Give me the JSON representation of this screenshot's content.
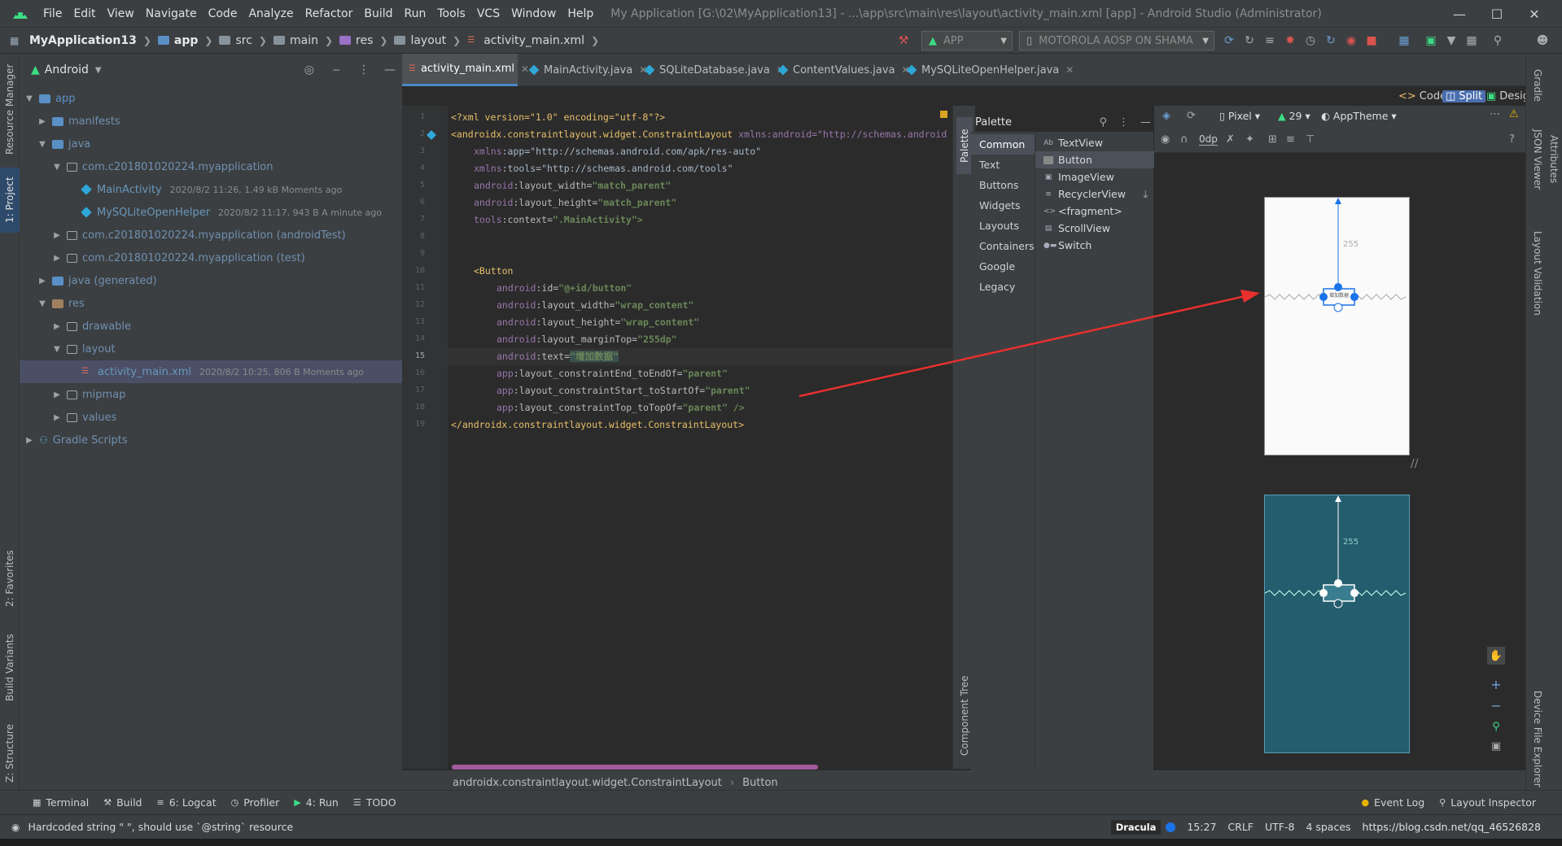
{
  "window": {
    "title": "My Application [G:\\02\\MyApplication13] - ...\\app\\src\\main\\res\\layout\\activity_main.xml [app] - Android Studio (Administrator)",
    "menu": [
      "File",
      "Edit",
      "View",
      "Navigate",
      "Code",
      "Analyze",
      "Refactor",
      "Build",
      "Run",
      "Tools",
      "VCS",
      "Window",
      "Help"
    ]
  },
  "navbar": {
    "crumbs": [
      "MyApplication13",
      "app",
      "src",
      "main",
      "res",
      "layout",
      "activity_main.xml"
    ],
    "run_config": "APP",
    "device": "MOTOROLA AOSP ON SHAMA"
  },
  "project": {
    "view_label": "Android",
    "tree": [
      {
        "label": "app",
        "meta": ""
      },
      {
        "label": "manifests",
        "meta": ""
      },
      {
        "label": "java",
        "meta": ""
      },
      {
        "label": "com.c201801020224.myapplication",
        "meta": ""
      },
      {
        "label": "MainActivity",
        "meta": "2020/8/2 11:26, 1.49 kB  Moments ago"
      },
      {
        "label": "MySQLiteOpenHelper",
        "meta": "2020/8/2 11:17, 943 B  A minute ago"
      },
      {
        "label": "com.c201801020224.myapplication (androidTest)",
        "meta": ""
      },
      {
        "label": "com.c201801020224.myapplication (test)",
        "meta": ""
      },
      {
        "label": "java (generated)",
        "meta": ""
      },
      {
        "label": "res",
        "meta": ""
      },
      {
        "label": "drawable",
        "meta": ""
      },
      {
        "label": "layout",
        "meta": ""
      },
      {
        "label": "activity_main.xml",
        "meta": "2020/8/2 10:25, 806 B  Moments ago"
      },
      {
        "label": "mipmap",
        "meta": ""
      },
      {
        "label": "values",
        "meta": ""
      },
      {
        "label": "Gradle Scripts",
        "meta": ""
      }
    ]
  },
  "left_strip": {
    "resource_manager": "Resource Manager",
    "project": "1: Project",
    "favorites": "2: Favorites",
    "build_variants": "Build Variants",
    "structure": "Z: Structure"
  },
  "editor": {
    "tabs": [
      "activity_main.xml",
      "MainActivity.java",
      "SQLiteDatabase.java",
      "ContentValues.java",
      "MySQLiteOpenHelper.java"
    ],
    "line_numbers": [
      "1",
      "2",
      "3",
      "4",
      "5",
      "6",
      "7",
      "8",
      "9",
      "10",
      "11",
      "12",
      "13",
      "14",
      "15",
      "16",
      "17",
      "18",
      "19"
    ],
    "lines": {
      "l1": "<?xml version=\"1.0\" encoding=\"utf-8\"?>",
      "l2_tag": "<androidx.constraintlayout.widget.ConstraintLayout",
      "l2_attr": " xmlns:android=\"http://schemas.android",
      "l3_ns": "xmlns",
      "l3_rest": ":app=\"http://schemas.android.com/apk/res-auto\"",
      "l4_ns": "xmlns",
      "l4_rest": ":tools=\"http://schemas.android.com/tools\"",
      "l5_ns": "android",
      "l5_attr": ":layout_width=",
      "l5_val": "\"match_parent\"",
      "l6_ns": "android",
      "l6_attr": ":layout_height=",
      "l6_val": "\"match_parent\"",
      "l7_ns": "tools",
      "l7_attr": ":context=",
      "l7_val": "\".MainActivity\">",
      "l10": "<Button",
      "l11_ns": "android",
      "l11_attr": ":id=",
      "l11_val": "\"@+id/button\"",
      "l12_ns": "android",
      "l12_attr": ":layout_width=",
      "l12_val": "\"wrap_content\"",
      "l13_ns": "android",
      "l13_attr": ":layout_height=",
      "l13_val": "\"wrap_content\"",
      "l14_ns": "android",
      "l14_attr": ":layout_marginTop=",
      "l14_val": "\"255dp\"",
      "l15_ns": "android",
      "l15_attr": ":text=",
      "l15_val": "\"增加数据\"",
      "l16_ns": "app",
      "l16_attr": ":layout_constraintEnd_toEndOf=",
      "l16_val": "\"parent\"",
      "l17_ns": "app",
      "l17_attr": ":layout_constraintStart_toStartOf=",
      "l17_val": "\"parent\"",
      "l18_ns": "app",
      "l18_attr": ":layout_constraintTop_toTopOf=",
      "l18_val": "\"parent\" />",
      "l19": "</androidx.constraintlayout.widget.ConstraintLayout>"
    },
    "breadcrumb": [
      "androidx.constraintlayout.widget.ConstraintLayout",
      "Button"
    ]
  },
  "view_modes": {
    "code": "Code",
    "split": "Split",
    "design": "Design"
  },
  "palette": {
    "title": "Palette",
    "strip_label": "Palette",
    "categories": [
      "Common",
      "Text",
      "Buttons",
      "Widgets",
      "Layouts",
      "Containers",
      "Google",
      "Legacy"
    ],
    "items": [
      "TextView",
      "Button",
      "ImageView",
      "RecyclerView",
      "<fragment>",
      "ScrollView",
      "Switch"
    ],
    "component_tree": "Component Tree"
  },
  "design_toolbar": {
    "device": "Pixel",
    "api": "29",
    "theme": "AppTheme",
    "margin": "0dp"
  },
  "design_surface": {
    "margin_label": "255",
    "button_text": "增加数据"
  },
  "right_strip": {
    "gradle": "Gradle",
    "json_viewer": "JSON Viewer",
    "attributes": "Attributes",
    "layout_validation": "Layout Validation",
    "device_file_explorer": "Device File Explorer"
  },
  "bottom_tools": {
    "terminal": "Terminal",
    "build": "Build",
    "logcat": "6: Logcat",
    "profiler": "Profiler",
    "run": "4: Run",
    "todo": "TODO",
    "event_log": "Event Log",
    "layout_inspector": "Layout Inspector"
  },
  "statusbar": {
    "message": "Hardcoded string \" \", should use `@string` resource",
    "theme": "Dracula",
    "position": "15:27",
    "line_sep": "CRLF",
    "encoding": "UTF-8",
    "indent": "4 spaces",
    "watermark": "https://blog.csdn.net/qq_46526828"
  },
  "colors": {
    "accent": "#4a88c7",
    "annotation_arrow": "#e8302e",
    "button_blue": "#1a73e8",
    "dark_preview": "#235d6e"
  }
}
